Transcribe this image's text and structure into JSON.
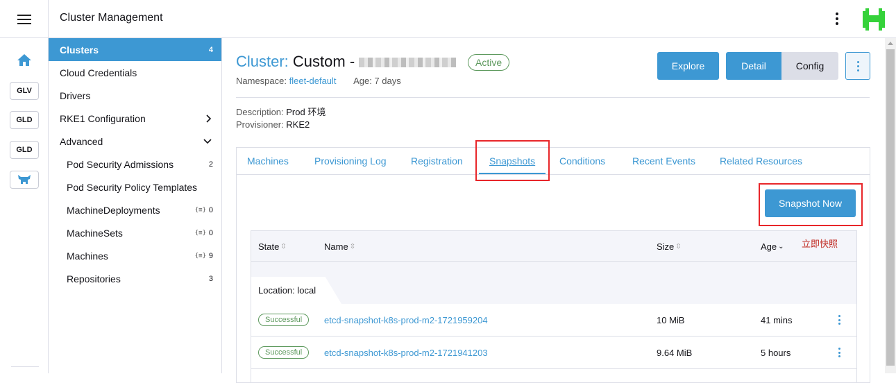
{
  "header": {
    "title": "Cluster Management"
  },
  "rail": {
    "badges": [
      "GLV",
      "GLD",
      "GLD"
    ]
  },
  "sidenav": {
    "items": [
      {
        "label": "Clusters",
        "count": "4"
      },
      {
        "label": "Cloud Credentials"
      },
      {
        "label": "Drivers"
      },
      {
        "label": "RKE1 Configuration"
      },
      {
        "label": "Advanced"
      },
      {
        "label": "Pod Security Admissions",
        "count": "2"
      },
      {
        "label": "Pod Security Policy Templates"
      },
      {
        "label": "MachineDeployments",
        "count": "0"
      },
      {
        "label": "MachineSets",
        "count": "0"
      },
      {
        "label": "Machines",
        "count": "9"
      },
      {
        "label": "Repositories",
        "count": "3"
      }
    ],
    "link_icon": "{≡}"
  },
  "cluster": {
    "label": "Cluster:",
    "name": "Custom -",
    "status": "Active",
    "namespace_label": "Namespace:",
    "namespace": "fleet-default",
    "age": "Age: 7 days",
    "description_label": "Description:",
    "description": "Prod 环境",
    "provisioner_label": "Provisioner:",
    "provisioner": "RKE2"
  },
  "actions": {
    "explore": "Explore",
    "detail": "Detail",
    "config": "Config"
  },
  "tabs": [
    "Machines",
    "Provisioning Log",
    "Registration",
    "Snapshots",
    "Conditions",
    "Recent Events",
    "Related Resources"
  ],
  "snapshot_button": "Snapshot Now",
  "annotation": "立即快照",
  "table": {
    "columns": [
      "State",
      "Name",
      "Size",
      "Age"
    ],
    "group_label": "Location: local",
    "rows": [
      {
        "state": "Successful",
        "name": "etcd-snapshot-k8s-prod-m2-1721959204",
        "size": "10 MiB",
        "age": "41 mins"
      },
      {
        "state": "Successful",
        "name": "etcd-snapshot-k8s-prod-m2-1721941203",
        "size": "9.64 MiB",
        "age": "5 hours"
      }
    ]
  },
  "colors": {
    "accent": "#3d98d3",
    "success": "#5d995d",
    "annotation": "#e8262a"
  }
}
